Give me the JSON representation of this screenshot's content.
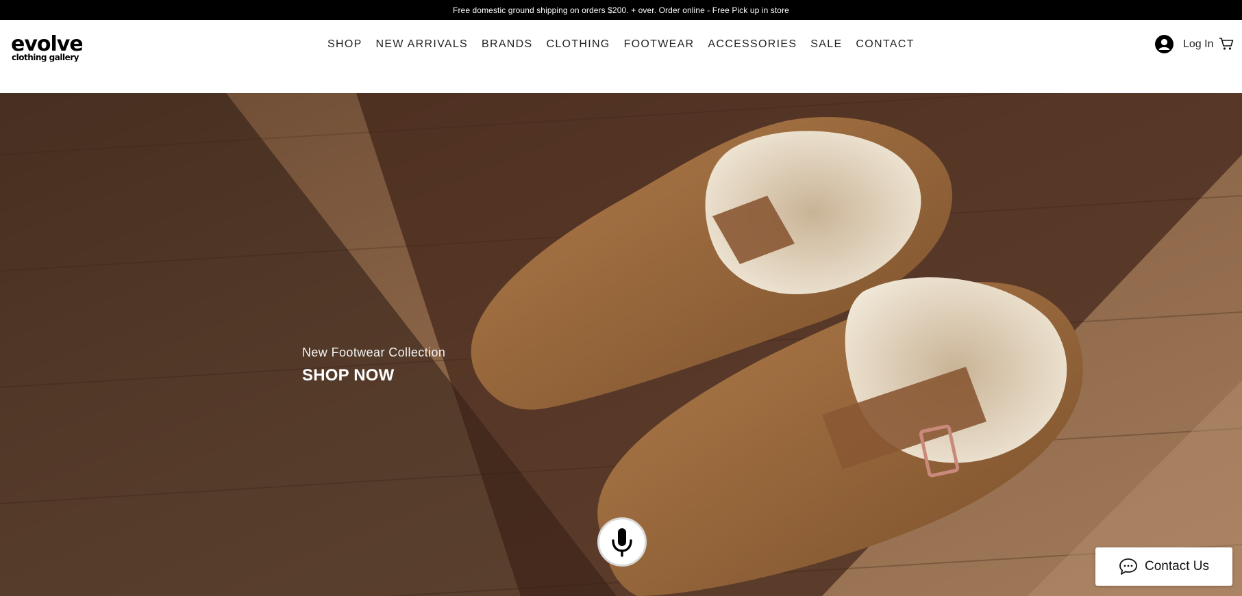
{
  "announcement": "Free domestic ground shipping on orders $200. + over.  Order online - Free Pick up in store",
  "brand": {
    "logo_main": "evolve",
    "logo_sub": "clothing gallery"
  },
  "nav": {
    "items": [
      {
        "label": "SHOP"
      },
      {
        "label": "NEW ARRIVALS"
      },
      {
        "label": "BRANDS"
      },
      {
        "label": "CLOTHING"
      },
      {
        "label": "FOOTWEAR"
      },
      {
        "label": "ACCESSORIES"
      },
      {
        "label": "SALE"
      },
      {
        "label": "CONTACT"
      }
    ]
  },
  "account": {
    "login_label": "Log In",
    "icons": [
      "avatar-icon",
      "cart-icon"
    ]
  },
  "hero": {
    "subtitle": "New Footwear Collection",
    "cta": "SHOP NOW"
  },
  "widgets": {
    "mic_icon": "microphone-icon",
    "contact_label": "Contact Us",
    "contact_icon": "chat-bubble-icon"
  },
  "colors": {
    "announcement_bg": "#000000",
    "text": "#222222",
    "widget_bg": "#ffffff"
  }
}
